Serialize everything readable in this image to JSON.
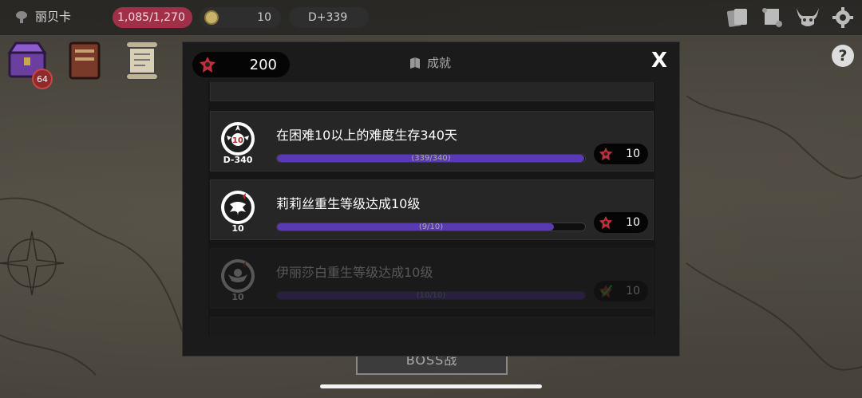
{
  "topbar": {
    "character_name": "丽贝卡",
    "hp": "1,085/1,270",
    "gold": "10",
    "day": "D+339"
  },
  "left_icons": {
    "chest_badge": "64"
  },
  "boss_label": "BOSS战",
  "modal": {
    "gems": "200",
    "title": "成就",
    "close_label": "X",
    "achievements": [
      {
        "emblem_label": "D-340",
        "title": "在困难10以上的难度生存340天",
        "progress_text": "(339/340)",
        "progress": 0.997,
        "reward": "10",
        "state": "active"
      },
      {
        "emblem_label": "10",
        "title": "莉莉丝重生等级达成10级",
        "progress_text": "(9/10)",
        "progress": 0.9,
        "reward": "10",
        "state": "active"
      },
      {
        "emblem_label": "10",
        "title": "伊丽莎白重生等级达成10级",
        "progress_text": "(10/10)",
        "progress": 1.0,
        "reward": "10",
        "state": "claimed"
      }
    ]
  },
  "colors": {
    "progress_fill": "#5a3ab0",
    "hp_pill": "#a03048",
    "gem_red": "#c0303a"
  }
}
